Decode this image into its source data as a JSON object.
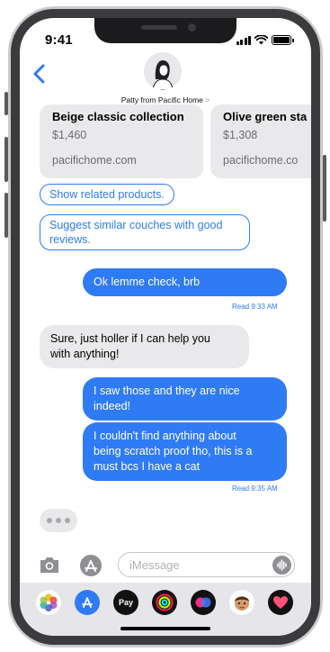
{
  "status": {
    "time": "9:41"
  },
  "header": {
    "contact_name": "Patty from Pacific Home",
    "chevron": ">"
  },
  "cards": [
    {
      "title": "Beige classic collection",
      "price": "$1,460",
      "domain": "pacifichome.com"
    },
    {
      "title": "Olive green sta",
      "price": "$1,308",
      "domain": "pacifichome.co"
    }
  ],
  "chips": [
    {
      "label": "Show related products."
    },
    {
      "label_line1": "Suggest similar couches with good",
      "label_line2": "reviews."
    }
  ],
  "messages": [
    {
      "direction": "out",
      "text": "Ok lemme check, brb"
    },
    {
      "direction": "in",
      "line1": "Sure, just holler if I can help you",
      "line2": "with anything!"
    },
    {
      "direction": "out",
      "line1": "I saw those and they are nice",
      "line2": "indeed!"
    },
    {
      "direction": "out",
      "line1": "I couldn't find anything about",
      "line2": "being scratch proof tho, this is a",
      "line3": "must bcs I have a cat"
    }
  ],
  "receipts": {
    "first": "Read 9:33 AM",
    "second": "Read 9:35 AM"
  },
  "input": {
    "placeholder": "iMessage"
  },
  "app_drawer": {
    "apps": [
      "photos-icon",
      "app-store-icon",
      "apple-pay-icon",
      "activity-icon",
      "digital-touch-icon",
      "memoji-icon",
      "heart-sticker-icon"
    ],
    "apple_pay_label": "Pay"
  },
  "colors": {
    "accent_blue": "#2f7bf5",
    "incoming_gray": "#e9e9eb"
  }
}
